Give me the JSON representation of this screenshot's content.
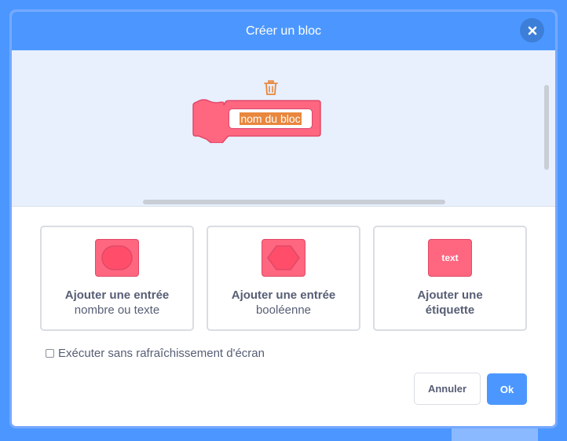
{
  "modal": {
    "title": "Créer un bloc",
    "close_icon": "close-icon"
  },
  "workspace": {
    "delete_icon": "trash-icon",
    "block_name": "nom du bloc",
    "block_color": "#ff6680"
  },
  "cards": [
    {
      "title": "Ajouter une entrée",
      "subtitle": "nombre ou texte",
      "icon": "number-text-input-icon"
    },
    {
      "title": "Ajouter une entrée",
      "subtitle": "booléenne",
      "icon": "boolean-input-icon"
    },
    {
      "title": "Ajouter une",
      "subtitle": "étiquette",
      "icon": "label-icon",
      "icon_text": "text"
    }
  ],
  "options": {
    "run_without_refresh_label": "Exécuter sans rafraîchissement d'écran",
    "run_without_refresh_checked": false
  },
  "buttons": {
    "cancel_label": "Annuler",
    "ok_label": "Ok"
  },
  "colors": {
    "accent": "#4c97ff",
    "text": "#575e75",
    "block": "#ff6680",
    "selection": "#e8873d"
  }
}
